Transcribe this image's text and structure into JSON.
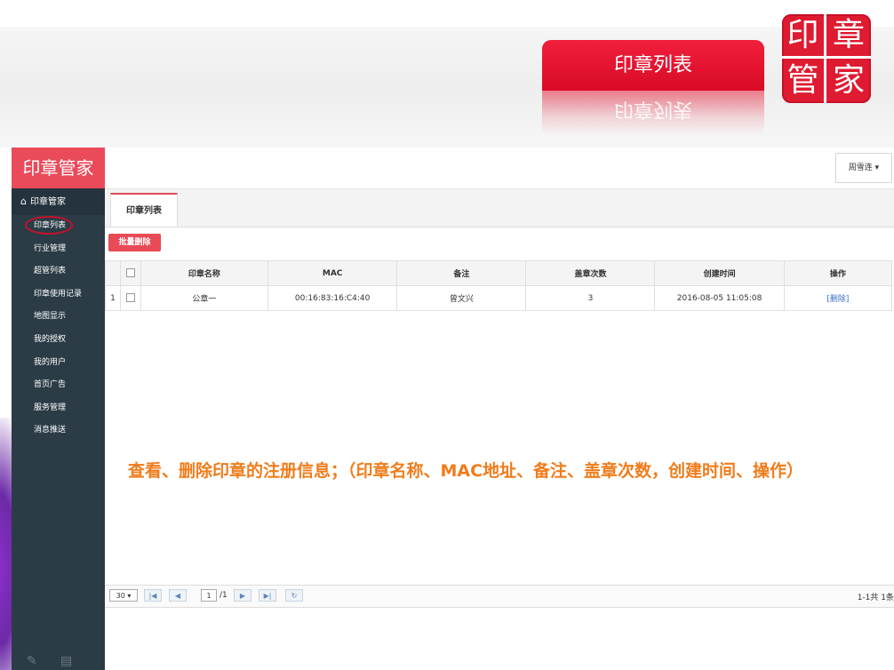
{
  "slide": {
    "ribbon_title": "印章列表",
    "ribbon_reflection": "印章列表",
    "seal_chars": [
      "印",
      "章",
      "管",
      "家"
    ],
    "annotation": "查看、删除印章的注册信息；（印章名称、MAC地址、备注、盖章次数，创建时间、操作）"
  },
  "sidebar": {
    "brand": "印章管家",
    "section_label": "印章管家",
    "items": [
      {
        "label": "印章列表"
      },
      {
        "label": "行业管理"
      },
      {
        "label": "超管列表"
      },
      {
        "label": "印章使用记录"
      },
      {
        "label": "地图显示"
      },
      {
        "label": "我的授权"
      },
      {
        "label": "我的用户"
      },
      {
        "label": "首页广告"
      },
      {
        "label": "服务管理"
      },
      {
        "label": "消息推送"
      }
    ]
  },
  "header": {
    "user": "周雪连 ▾"
  },
  "tabs": [
    {
      "label": "印章列表"
    }
  ],
  "toolbar": {
    "batch_delete": "批量删除"
  },
  "table": {
    "columns": [
      "印章名称",
      "MAC",
      "备注",
      "盖章次数",
      "创建时间",
      "操作"
    ],
    "rows": [
      {
        "index": "1",
        "name": "公章一",
        "mac": "00:16:83:16:C4:40",
        "note": "曾文兴",
        "count": "3",
        "created": "2016-08-05 11:05:08",
        "action": "[删除]"
      }
    ]
  },
  "pager": {
    "page_size": "30",
    "current_page": "1",
    "total_pages": "/1",
    "summary": "1-1共 1条"
  },
  "colors": {
    "accent_red": "#e84a56",
    "sidebar_bg": "#2b3c47",
    "annotation_orange": "#f07c1b"
  }
}
